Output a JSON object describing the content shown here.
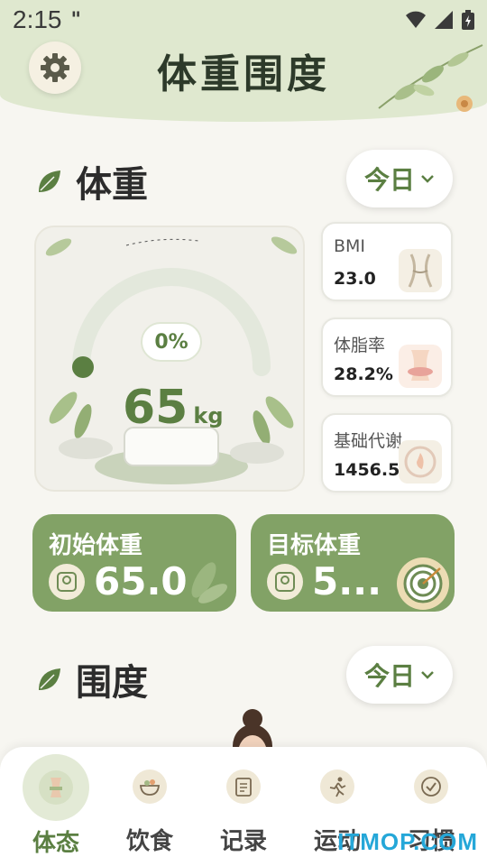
{
  "status_bar": {
    "time": "2:15",
    "extra": "\""
  },
  "app": {
    "title": "体重围度"
  },
  "weight_section": {
    "title": "体重",
    "period_select": "今日",
    "gauge": {
      "percent_label": "0%",
      "progress": 0,
      "value": "65",
      "unit": "kg"
    },
    "metrics": [
      {
        "label": "BMI",
        "value": "23.0",
        "icon": "waist-icon"
      },
      {
        "label": "体脂率",
        "value": "28.2%",
        "icon": "body-fat-icon"
      },
      {
        "label": "基础代谢",
        "value": "1456.5",
        "icon": "metabolism-icon"
      }
    ],
    "initial": {
      "label": "初始体重",
      "value": "65.0"
    },
    "target": {
      "label": "目标体重",
      "value": "5..."
    }
  },
  "girth_section": {
    "title": "围度",
    "period_select": "今日"
  },
  "bottom_nav": {
    "items": [
      {
        "label": "体态",
        "icon": "body-icon",
        "active": true
      },
      {
        "label": "饮食",
        "icon": "food-bowl-icon",
        "active": false
      },
      {
        "label": "记录",
        "icon": "notebook-icon",
        "active": false
      },
      {
        "label": "运动",
        "icon": "running-icon",
        "active": false
      },
      {
        "label": "习惯",
        "icon": "habit-check-icon",
        "active": false
      }
    ]
  },
  "watermark": "ITMOP.COM",
  "colors": {
    "accent": "#5b7f42",
    "card_green": "#82a266",
    "header_bg": "#dfe8cf",
    "page_bg": "#f7f6f1"
  }
}
